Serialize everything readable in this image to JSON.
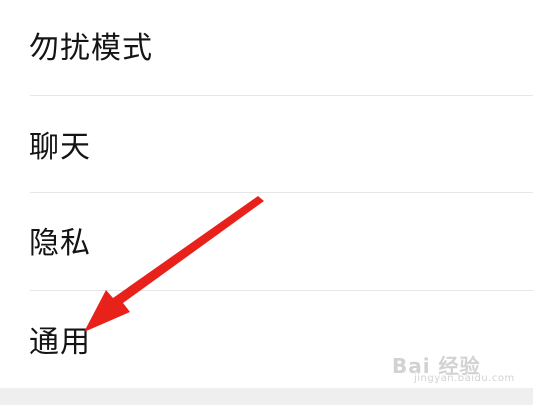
{
  "settings": {
    "items": [
      {
        "label": "勿扰模式"
      },
      {
        "label": "聊天"
      },
      {
        "label": "隐私"
      },
      {
        "label": "通用"
      }
    ]
  },
  "annotation": {
    "arrow_color": "#e8221b",
    "points_to": "通用"
  },
  "watermark": {
    "logo_text": "Bai 经验",
    "url": "jingyan.baidu.com"
  }
}
